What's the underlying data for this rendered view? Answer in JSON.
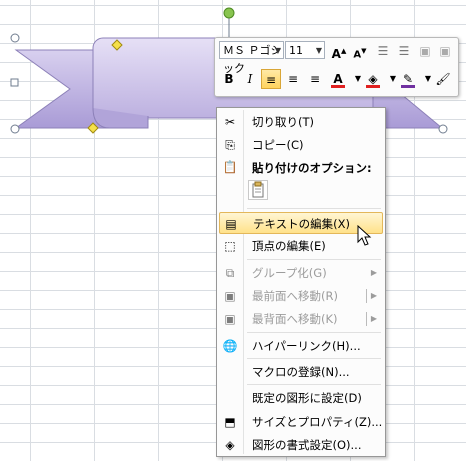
{
  "toolbar": {
    "font_name": "ＭＳ Ｐゴシック",
    "font_size": "11",
    "increase_font_icon": "A˄",
    "decrease_font_icon": "A˅",
    "bold_label": "B",
    "italic_label": "I",
    "font_color_label": "A"
  },
  "menu": {
    "items": [
      {
        "label": "切り取り(T)",
        "icon": "scissors-icon",
        "enabled": true
      },
      {
        "label": "コピー(C)",
        "icon": "copy-icon",
        "enabled": true
      },
      {
        "label": "貼り付けのオプション:",
        "icon": "paste-icon",
        "enabled": true,
        "header": true
      },
      {
        "label": "テキストの編集(X)",
        "icon": "text-edit-icon",
        "enabled": true,
        "highlighted": true
      },
      {
        "label": "頂点の編集(E)",
        "icon": "edit-points-icon",
        "enabled": true
      },
      {
        "label": "グループ化(G)",
        "icon": "group-icon",
        "enabled": false,
        "submenu": true
      },
      {
        "label": "最前面へ移動(R)",
        "icon": "bring-front-icon",
        "enabled": false,
        "submenu": true
      },
      {
        "label": "最背面へ移動(K)",
        "icon": "send-back-icon",
        "enabled": false,
        "submenu": true
      },
      {
        "label": "ハイパーリンク(H)...",
        "icon": "hyperlink-icon",
        "enabled": true
      },
      {
        "label": "マクロの登録(N)...",
        "icon": "",
        "enabled": true
      },
      {
        "label": "既定の図形に設定(D)",
        "icon": "",
        "enabled": true
      },
      {
        "label": "サイズとプロパティ(Z)...",
        "icon": "size-properties-icon",
        "enabled": true
      },
      {
        "label": "図形の書式設定(O)...",
        "icon": "format-shape-icon",
        "enabled": true
      }
    ]
  },
  "colors": {
    "ribbon_fill": "#c9bfe6",
    "ribbon_stroke": "#8c80b8",
    "highlight": "#ffe28a",
    "font_color_bar": "#e02020",
    "fill_color_bar": "#e02020",
    "line_color_bar": "#7030a0"
  }
}
